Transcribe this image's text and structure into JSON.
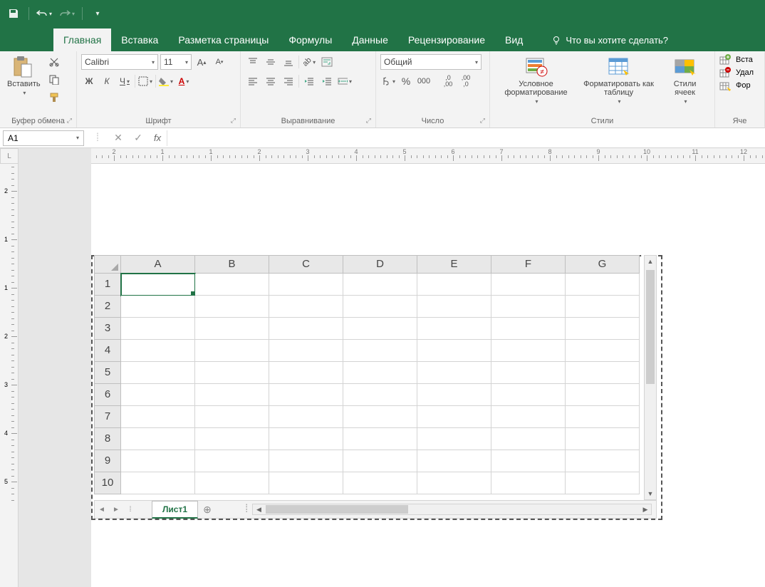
{
  "qat": {
    "save_icon": "save-icon",
    "undo_icon": "undo-icon",
    "redo_icon": "redo-icon"
  },
  "tabs": {
    "items": [
      {
        "label": "Главная",
        "active": true
      },
      {
        "label": "Вставка"
      },
      {
        "label": "Разметка страницы"
      },
      {
        "label": "Формулы"
      },
      {
        "label": "Данные"
      },
      {
        "label": "Рецензирование"
      },
      {
        "label": "Вид"
      }
    ],
    "tellme": "Что вы хотите сделать?"
  },
  "ribbon": {
    "clipboard": {
      "paste": "Вставить",
      "label": "Буфер обмена"
    },
    "font": {
      "name": "Calibri",
      "size": "11",
      "bold": "Ж",
      "italic": "К",
      "underline": "Ч",
      "label": "Шрифт"
    },
    "alignment": {
      "label": "Выравнивание"
    },
    "number": {
      "format": "Общий",
      "label": "Число"
    },
    "styles": {
      "conditional": "Условное форматирование",
      "table": "Форматировать как таблицу",
      "cell": "Стили ячеек",
      "label": "Стили"
    },
    "cells": {
      "insert": "Вста",
      "delete": "Удал",
      "format": "Фор",
      "label": "Яче"
    }
  },
  "formula_bar": {
    "name_box": "A1",
    "fx": "fx",
    "value": ""
  },
  "ruler": {
    "unit": "L",
    "hnums": [
      2,
      1,
      1,
      2,
      3,
      4,
      5,
      6,
      7,
      8,
      9,
      10,
      11,
      12
    ],
    "vnums": [
      2,
      1,
      1,
      2,
      3,
      4,
      5
    ]
  },
  "grid": {
    "columns": [
      "A",
      "B",
      "C",
      "D",
      "E",
      "F",
      "G"
    ],
    "rows": [
      "1",
      "2",
      "3",
      "4",
      "5",
      "6",
      "7",
      "8",
      "9",
      "10"
    ],
    "active_cell": "A1"
  },
  "sheets": {
    "active": "Лист1"
  }
}
